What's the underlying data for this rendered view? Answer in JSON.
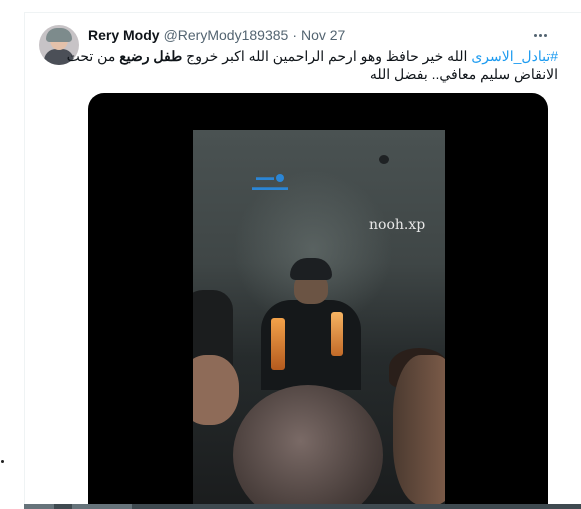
{
  "tweet": {
    "author": {
      "display_name": "Rery Mody",
      "handle": "@ReryMody189385",
      "separator": "·",
      "date": "Nov 27"
    },
    "text": {
      "hashtag": "#تبادل_الاسرى",
      "line1_middle": " الله خير حافظ وهو ارحم الراحمين  الله اكبر خروج ",
      "line1_bold": "طفل رضيع",
      "line1_end": " من تحت",
      "line2": "الانقاض سليم معافي.. بفضل الله"
    },
    "media": {
      "watermark": "nooh.xp"
    },
    "icons": {
      "more": "more-horizontal-icon"
    }
  }
}
